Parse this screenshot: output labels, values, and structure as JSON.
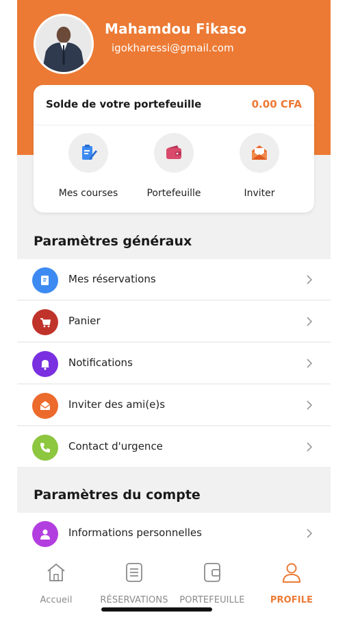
{
  "profile": {
    "name": "Mahamdou Fikaso",
    "email": "igokharessi@gmail.com"
  },
  "wallet": {
    "label": "Solde de votre portefeuille",
    "amount": "0.00 CFA",
    "actions": [
      {
        "label": "Mes courses",
        "icon": "clipboard-pen-icon"
      },
      {
        "label": "Portefeuille",
        "icon": "wallet-icon"
      },
      {
        "label": "Inviter",
        "icon": "envelope-open-icon"
      }
    ]
  },
  "general_settings": {
    "title": "Paramètres généraux",
    "items": [
      {
        "label": "Mes réservations",
        "icon": "clipboard-icon",
        "color": "#3d8bf2"
      },
      {
        "label": "Panier",
        "icon": "cart-icon",
        "color": "#c0332b"
      },
      {
        "label": "Notifications",
        "icon": "bell-icon",
        "color": "#7a2fe0"
      },
      {
        "label": "Inviter des ami(e)s",
        "icon": "envelope-icon",
        "color": "#ec6a2c"
      },
      {
        "label": "Contact d'urgence",
        "icon": "phone-icon",
        "color": "#8dc63f"
      }
    ]
  },
  "account_settings": {
    "title": "Paramètres du compte",
    "items": [
      {
        "label": "Informations personnelles",
        "icon": "user-icon",
        "color": "#b33ee0"
      }
    ]
  },
  "tabbar": {
    "tabs": [
      {
        "label": "Accueil",
        "icon": "home-icon",
        "active": false
      },
      {
        "label": "RÉSERVATIONS",
        "icon": "list-icon",
        "active": false
      },
      {
        "label": "PORTEFEUILLE",
        "icon": "wallet-icon",
        "active": false
      },
      {
        "label": "PROFILE",
        "icon": "user-icon",
        "active": true
      }
    ]
  },
  "colors": {
    "accent": "#ec7a34",
    "background": "#f1f1f1"
  }
}
